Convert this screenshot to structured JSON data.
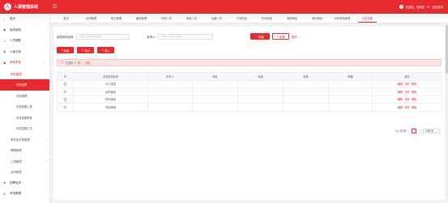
{
  "header": {
    "logo_glyph": "人",
    "title": "人事管理系统",
    "welcome": "欢迎您，管理员",
    "logout": "退出登录"
  },
  "sidebar": {
    "items": [
      {
        "icon": "home-icon",
        "label": "首页"
      },
      {
        "icon": "org-icon",
        "label": "组织架构"
      },
      {
        "icon": "people-icon",
        "label": "人员调配"
      },
      {
        "icon": "document-icon",
        "label": "人事业务"
      },
      {
        "icon": "calendar-icon",
        "label": "绩效考核"
      }
    ],
    "sub_open": "绩效管理",
    "subsub": [
      "绩效设置",
      "绩效管理",
      "绩效结果上报",
      "绩效结果审批",
      "绩效结果汇总"
    ],
    "items_after": [
      {
        "icon": "",
        "label": "考勤及日常管理"
      },
      {
        "icon": "",
        "label": "薪酬管理"
      },
      {
        "icon": "",
        "label": "工资管理"
      },
      {
        "icon": "",
        "label": "合同管理"
      },
      {
        "icon": "person-icon",
        "label": "招聘培训"
      },
      {
        "icon": "gear-icon",
        "label": "系统管理"
      }
    ]
  },
  "tabs": [
    "首页",
    "机构管理",
    "职位管理",
    "编制管理",
    "任职人员",
    "离退人员",
    "后备人员",
    "干部任免",
    "任免审批",
    "调配审批",
    "调岗审批",
    "绩效考核管理",
    "绩效设置"
  ],
  "search": {
    "name_label": "绩效机构名称:",
    "name_placeholder": "请输入绩效机构名称",
    "owner_label": "负责人:",
    "owner_placeholder": "请输入负责人名称",
    "search_btn": "搜索",
    "reset_btn": "重置",
    "expand_link": "展开"
  },
  "toolbar": {
    "add": "新增",
    "export": "导出",
    "import": "导入"
  },
  "alert": {
    "prefix": "已选择",
    "count": "0",
    "suffix": "项",
    "clear": "清空"
  },
  "table": {
    "headers": [
      "",
      "绩效机构名称",
      "负责人",
      "地址",
      "电话",
      "传真",
      "邮编",
      "操作"
    ],
    "rows": [
      [
        "",
        "办公室组",
        "",
        "",
        "",
        "",
        "",
        ""
      ],
      [
        "",
        "后勤保组",
        "",
        "",
        "",
        "",
        "",
        ""
      ],
      [
        "",
        "财务部组",
        "",
        "",
        "",
        "",
        "",
        ""
      ],
      [
        "",
        "内部审组",
        "",
        "",
        "",
        "",
        "",
        ""
      ]
    ],
    "ops": [
      "编辑",
      "详情",
      "删除"
    ]
  },
  "pagination": {
    "range": "1-4 共4条",
    "page": "1",
    "page_size": "10条/页"
  },
  "colors": {
    "brand": "#e8292d",
    "alert_bg": "#fde2e2"
  }
}
